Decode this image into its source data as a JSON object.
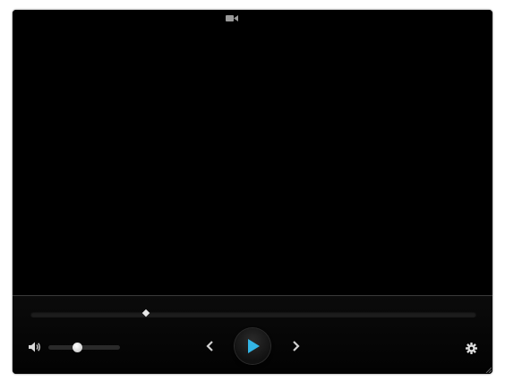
{
  "window": {
    "background": "#000000",
    "accent": "#33b5e5"
  },
  "video": {
    "indicator_icon": "camera-icon"
  },
  "seek_bar": {
    "position_fraction": 0.26
  },
  "volume": {
    "icon": "speaker-icon",
    "level_fraction": 0.4
  },
  "controls": {
    "prev_icon": "chevron-left-icon",
    "play_icon": "play-icon",
    "next_icon": "chevron-right-icon",
    "settings_icon": "gear-icon"
  }
}
